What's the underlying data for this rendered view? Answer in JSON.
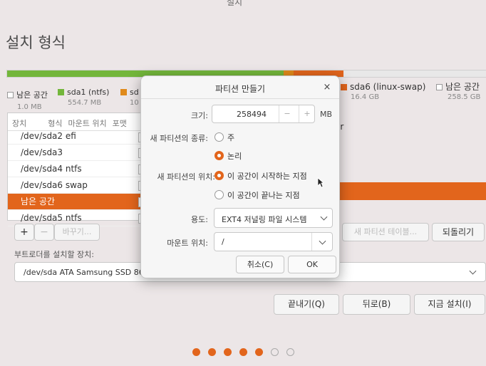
{
  "window": {
    "top_fragment": "설치",
    "title": "설치 형식"
  },
  "disk_bar": {
    "legend": [
      {
        "label": "남은 공간",
        "size": "1.0 MB",
        "color": "#ffffff"
      },
      {
        "label": "sda1 (ntfs)",
        "size": "554.7 MB",
        "color": "#73b63b"
      },
      {
        "label": "sd",
        "size": "10",
        "color": "#e08a1b"
      },
      {
        "label": "sda6 (linux-swap)",
        "size": "16.4 GB",
        "color": "#e2651c"
      },
      {
        "label": "남은 공간",
        "size": "258.5 GB",
        "color": "#ffffff"
      }
    ]
  },
  "table": {
    "headers": [
      "장치",
      "형식",
      "마운트 위치",
      "포맷"
    ],
    "rows": [
      {
        "text": "/dev/sda2  efi"
      },
      {
        "text": "/dev/sda3"
      },
      {
        "text": "/dev/sda4  ntfs"
      },
      {
        "text": "/dev/sda6  swap"
      },
      {
        "text": "남은 공간",
        "selected": true
      },
      {
        "text": "/dev/sda5  ntfs"
      }
    ],
    "right_fragment": "er"
  },
  "table_buttons": {
    "add": "+",
    "remove": "−",
    "change": "바꾸기..."
  },
  "right_buttons": {
    "new_table": "새 파티션 테이블...",
    "revert": "되돌리기"
  },
  "bootloader": {
    "label": "부트로더를 설치할 장치:",
    "value": "/dev/sda   ATA Samsung SSD 860"
  },
  "footer_buttons": {
    "quit": "끝내기(Q)",
    "back": "뒤로(B)",
    "install_now": "지금 설치(I)"
  },
  "progress": {
    "total_steps": 7,
    "completed_steps": 5
  },
  "dialog": {
    "title": "파티션 만들기",
    "close": "×",
    "size_label": "크기:",
    "size_value": "258494",
    "size_minus": "−",
    "size_plus": "+",
    "size_unit": "MB",
    "type_label": "새 파티션의 종류:",
    "type_primary": "주",
    "type_logical": "논리",
    "type_selected": "논리",
    "location_label": "새 파티션의 위치:",
    "location_start": "이 공간이 시작하는 지점",
    "location_end": "이 공간이 끝나는 지점",
    "location_selected": "이 공간이 시작하는 지점",
    "use_label": "용도:",
    "use_value": "EXT4 저널링 파일 시스템",
    "mount_label": "마운트 위치:",
    "mount_value": "/",
    "cancel": "취소(C)",
    "ok": "OK"
  },
  "colors": {
    "accent": "#e2651c",
    "ntfs_green": "#73b63b",
    "bar_orange": "#e08a1b"
  }
}
